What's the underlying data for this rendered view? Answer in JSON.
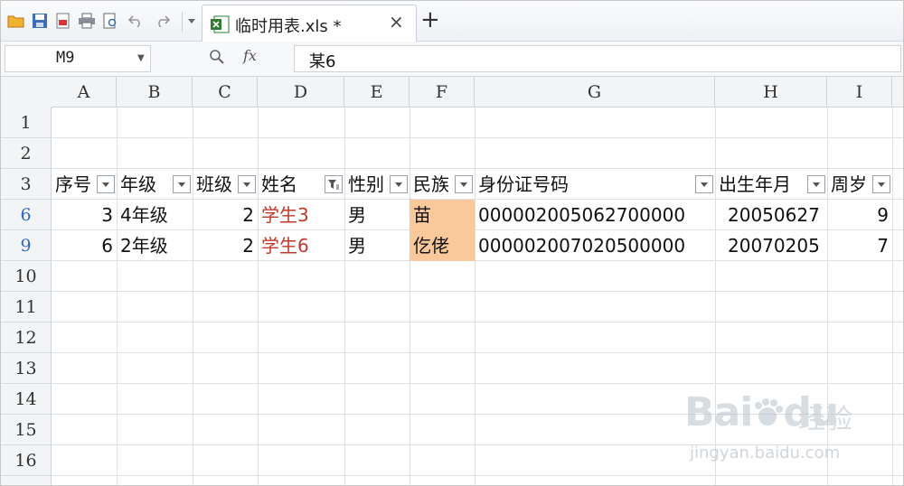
{
  "tab": {
    "file_name": "临时用表.xls *",
    "close_glyph": "×",
    "new_tab_glyph": "+"
  },
  "formula_bar": {
    "cell_ref": "M9",
    "fx_label": "fx",
    "value": "某6"
  },
  "columns": [
    "A",
    "B",
    "C",
    "D",
    "E",
    "F",
    "G",
    "H",
    "I"
  ],
  "rows": [
    "1",
    "2",
    "3",
    "6",
    "9",
    "10",
    "11",
    "12",
    "13",
    "14",
    "15",
    "16"
  ],
  "header_row": [
    "序号",
    "年级",
    "班级",
    "姓名",
    "性别",
    "民族",
    "身份证号码",
    "出生年月",
    "周岁"
  ],
  "data_rows": [
    [
      "3",
      "4年级",
      "2",
      "学生3",
      "男",
      "苗",
      "000002005062700000",
      "20050627",
      "9"
    ],
    [
      "6",
      "2年级",
      "2",
      "学生6",
      "男",
      "仡佬",
      "000002007020500000",
      "20070205",
      "7"
    ]
  ],
  "watermark": {
    "brand": "Bai",
    "brand_du": "du",
    "cn": "经验",
    "url": "jingyan.baidu.com"
  },
  "colors": {
    "accent_row": "#2f67c4",
    "highlight": "#f9c89b",
    "red_text": "#c0392b"
  }
}
